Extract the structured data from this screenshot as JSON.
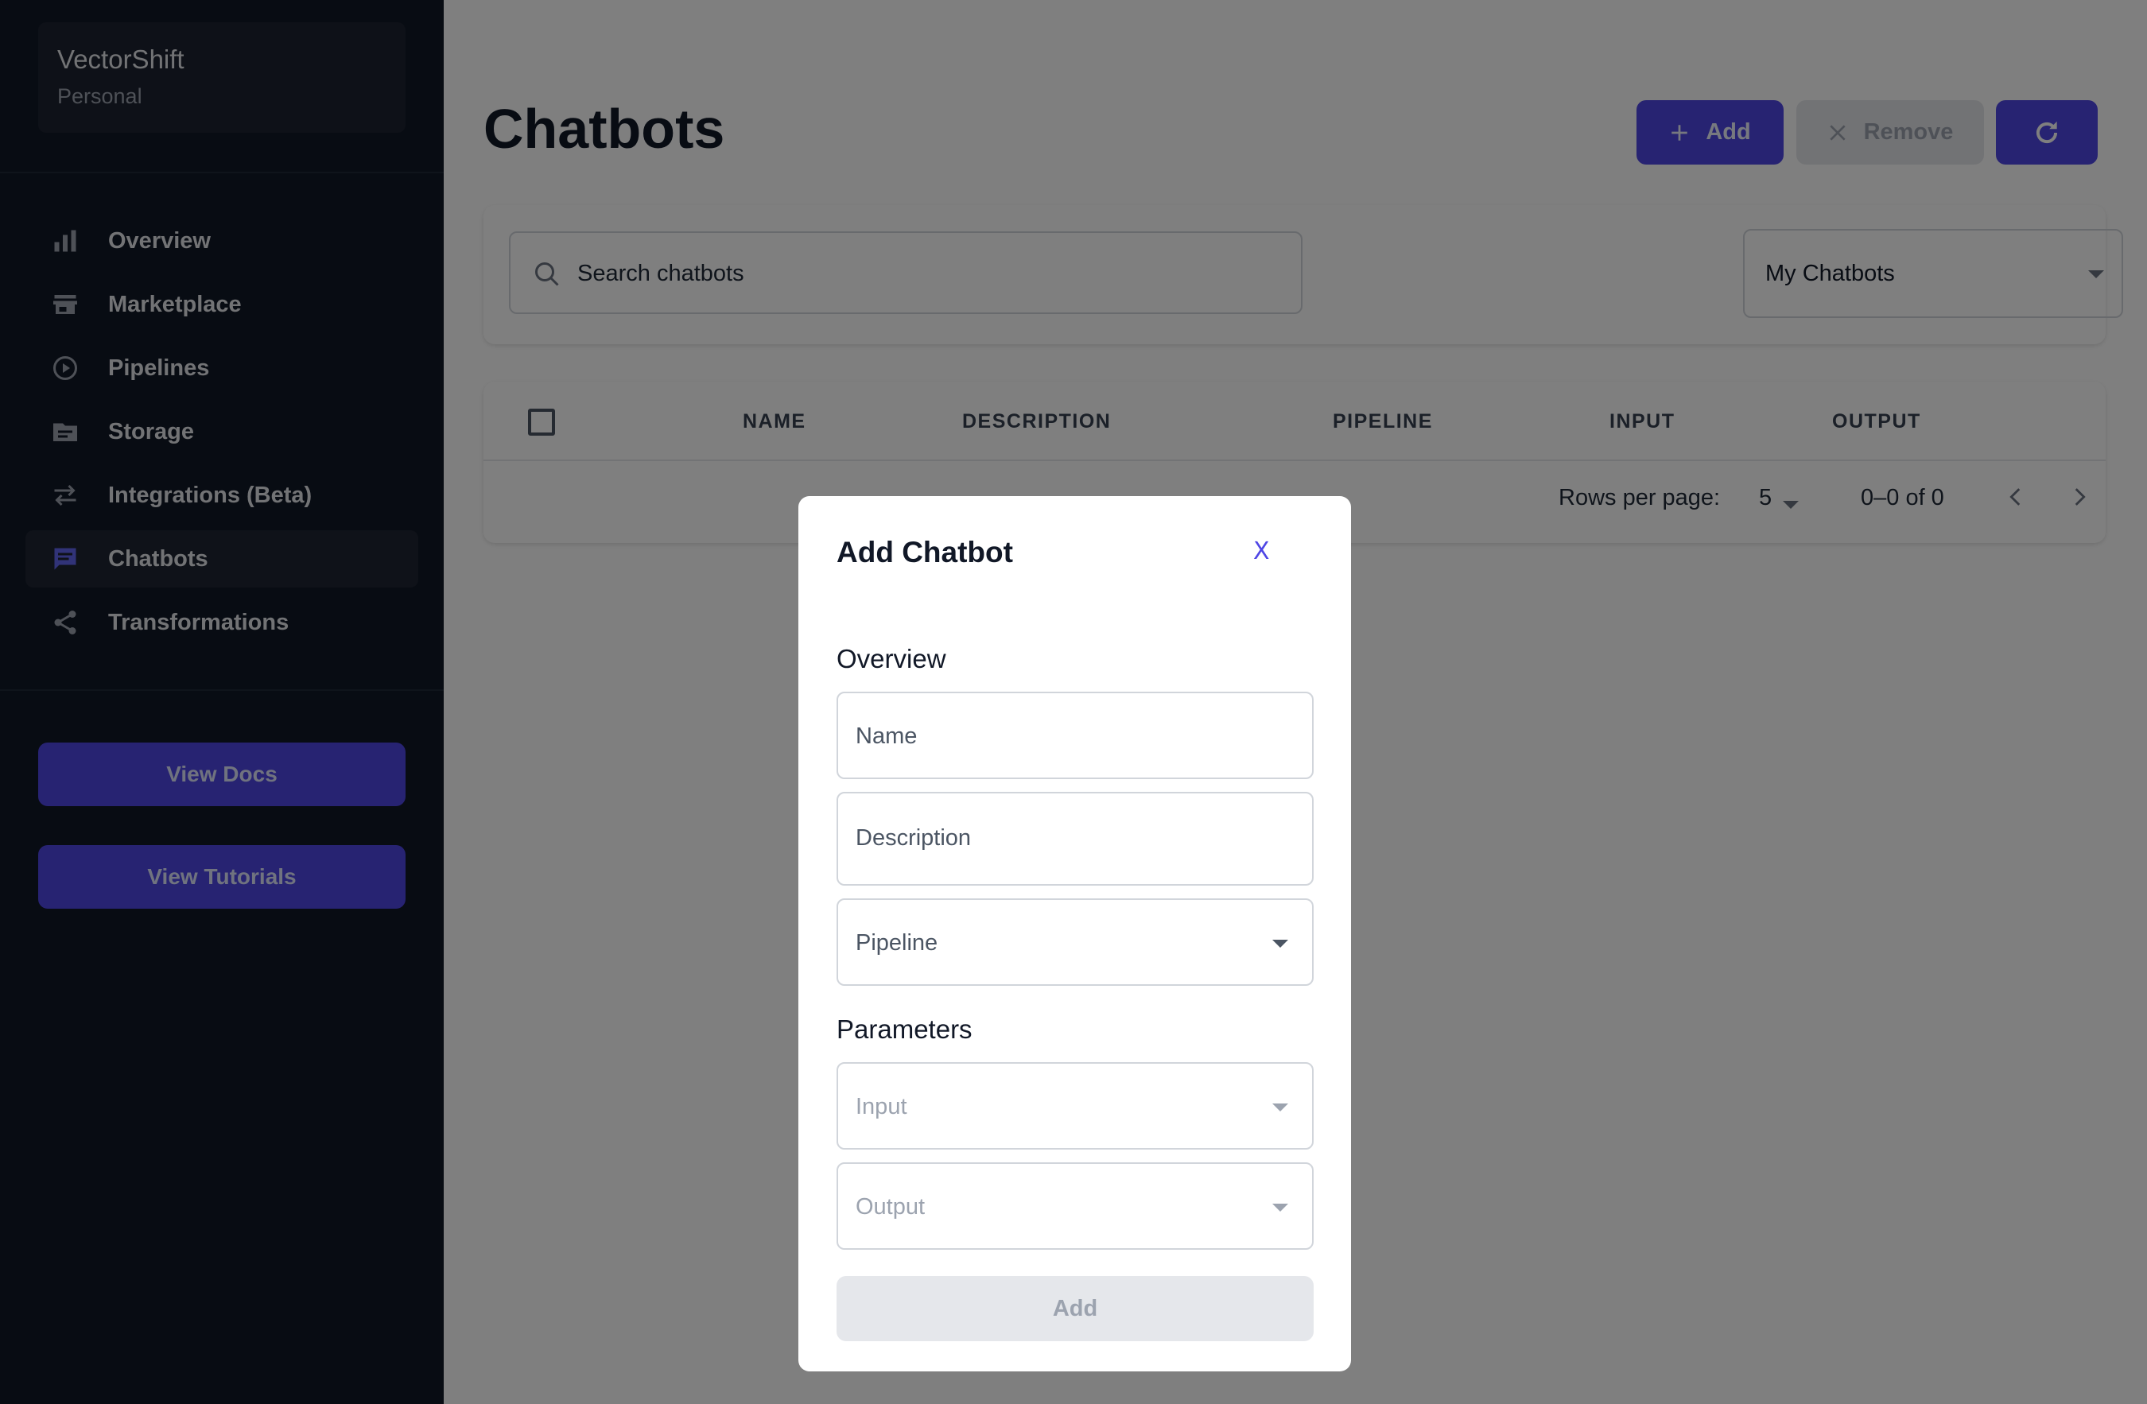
{
  "sidebar": {
    "workspace_name": "VectorShift",
    "workspace_type": "Personal",
    "items": [
      {
        "label": "Overview",
        "icon": "bar-chart-icon"
      },
      {
        "label": "Marketplace",
        "icon": "store-icon"
      },
      {
        "label": "Pipelines",
        "icon": "play-circle-icon"
      },
      {
        "label": "Storage",
        "icon": "folder-icon"
      },
      {
        "label": "Integrations (Beta)",
        "icon": "swap-arrows-icon"
      },
      {
        "label": "Chatbots",
        "icon": "chat-icon",
        "active": true
      },
      {
        "label": "Transformations",
        "icon": "share-icon"
      }
    ],
    "view_docs": "View Docs",
    "view_tutorials": "View Tutorials"
  },
  "main": {
    "title": "Chatbots",
    "add_label": "Add",
    "remove_label": "Remove",
    "search_placeholder": "Search chatbots",
    "filter_value": "My Chatbots",
    "table": {
      "columns": [
        "NAME",
        "DESCRIPTION",
        "PIPELINE",
        "INPUT",
        "OUTPUT"
      ],
      "rows": []
    },
    "pagination": {
      "rows_per_page_label": "Rows per page:",
      "rows_per_page": "5",
      "range": "0–0 of 0"
    }
  },
  "modal": {
    "title": "Add Chatbot",
    "close_label": "X",
    "overview_label": "Overview",
    "name_placeholder": "Name",
    "description_placeholder": "Description",
    "pipeline_placeholder": "Pipeline",
    "parameters_label": "Parameters",
    "input_placeholder": "Input",
    "output_placeholder": "Output",
    "submit_label": "Add"
  },
  "colors": {
    "accent": "#4f46e5",
    "sidebar_bg": "#111827",
    "overlay": "rgba(0,0,0,0.5)"
  }
}
